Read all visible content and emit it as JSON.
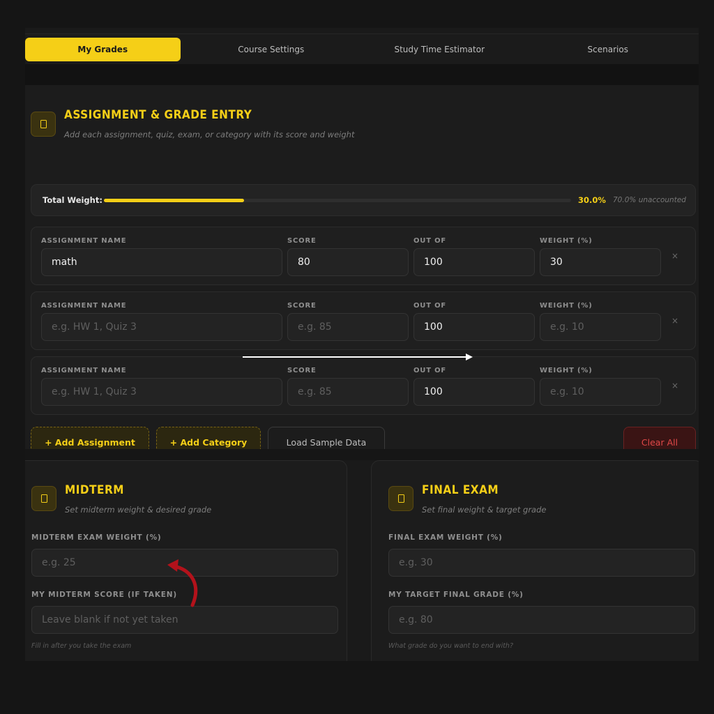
{
  "tabs": [
    {
      "label": "My Grades",
      "active": true
    },
    {
      "label": "Course Settings",
      "active": false
    },
    {
      "label": "Study Time Estimator",
      "active": false
    },
    {
      "label": "Scenarios",
      "active": false
    }
  ],
  "entry": {
    "title": "ASSIGNMENT & GRADE ENTRY",
    "subtitle": "Add each assignment, quiz, exam, or category with its score and weight",
    "icon": "document-icon"
  },
  "weight": {
    "label": "Total Weight:",
    "percent_text": "30.0%",
    "progress": 0.3,
    "unaccounted": "70.0% unaccounted"
  },
  "columns": {
    "name": "ASSIGNMENT NAME",
    "score": "SCORE",
    "out_of": "OUT OF",
    "weight": "WEIGHT (%)"
  },
  "rows": [
    {
      "name": "math",
      "name_placeholder": "",
      "score": "80",
      "score_placeholder": "",
      "out_of": "100",
      "weight": "30",
      "weight_placeholder": "",
      "remove": "×"
    },
    {
      "name": "",
      "name_placeholder": "e.g. HW 1, Quiz 3",
      "score": "",
      "score_placeholder": "e.g. 85",
      "out_of": "100",
      "weight": "",
      "weight_placeholder": "e.g. 10",
      "remove": "×"
    },
    {
      "name": "",
      "name_placeholder": "e.g. HW 1, Quiz 3",
      "score": "",
      "score_placeholder": "e.g. 85",
      "out_of": "100",
      "weight": "",
      "weight_placeholder": "e.g. 10",
      "remove": "×"
    }
  ],
  "buttons": {
    "add_assignment": "+ Add Assignment",
    "add_category": "+ Add Category",
    "load_sample": "Load Sample Data",
    "clear_all": "Clear All"
  },
  "midterm": {
    "title": "MIDTERM",
    "subtitle": "Set midterm weight & desired grade",
    "weight_label": "MIDTERM EXAM WEIGHT (%)",
    "weight_placeholder": "e.g. 25",
    "score_label": "MY MIDTERM SCORE (IF TAKEN)",
    "score_placeholder": "Leave blank if not yet taken",
    "hint": "Fill in after you take the exam"
  },
  "final": {
    "title": "FINAL EXAM",
    "subtitle": "Set final weight & target grade",
    "weight_label": "FINAL EXAM WEIGHT (%)",
    "weight_placeholder": "e.g. 30",
    "target_label": "MY TARGET FINAL GRADE (%)",
    "target_placeholder": "e.g. 80",
    "hint": "What grade do you want to end with?"
  },
  "colors": {
    "accent": "#f5cf17",
    "danger": "#e04848",
    "background": "#1a1a1a"
  }
}
